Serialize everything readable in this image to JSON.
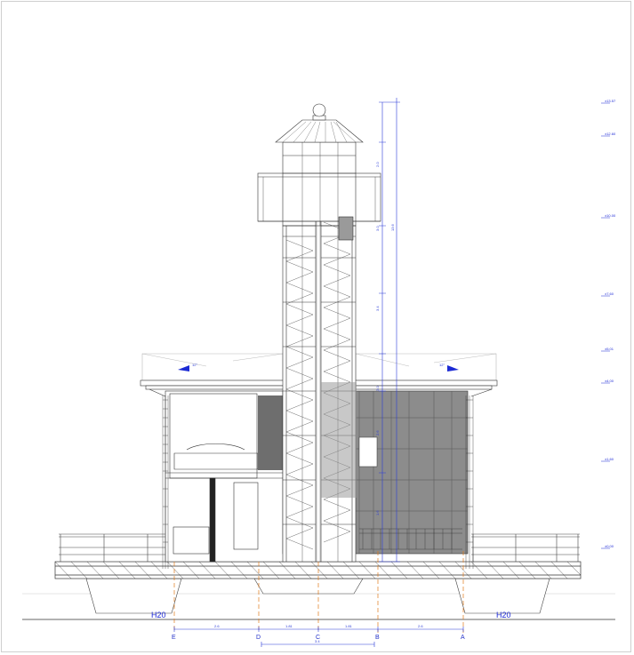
{
  "drawing": {
    "level_marks": [
      "±13.57",
      "±12.60",
      "±10.00",
      "±7.60",
      "±5.01",
      "±4.00",
      "±1.60",
      "±0.00"
    ],
    "grid_axes": [
      "E",
      "D",
      "C",
      "B",
      "A"
    ],
    "grid_dimensions": [
      "2.6",
      "1.81",
      "1.81",
      "2.6"
    ],
    "overall_dimension": "3.4",
    "vertical_dimensions": [
      "2.0",
      "3.0",
      "3.4",
      "3.0",
      "2.6",
      "1.6",
      "13.6"
    ],
    "pontoon_labels": [
      "H20",
      "H20"
    ],
    "roof_slope_labels": [
      "12°",
      "12°"
    ]
  },
  "colors": {
    "ink": "#333333",
    "dim": "#2b3bd8",
    "grid": "#e07a1a",
    "shade": "#8a8a8a"
  }
}
